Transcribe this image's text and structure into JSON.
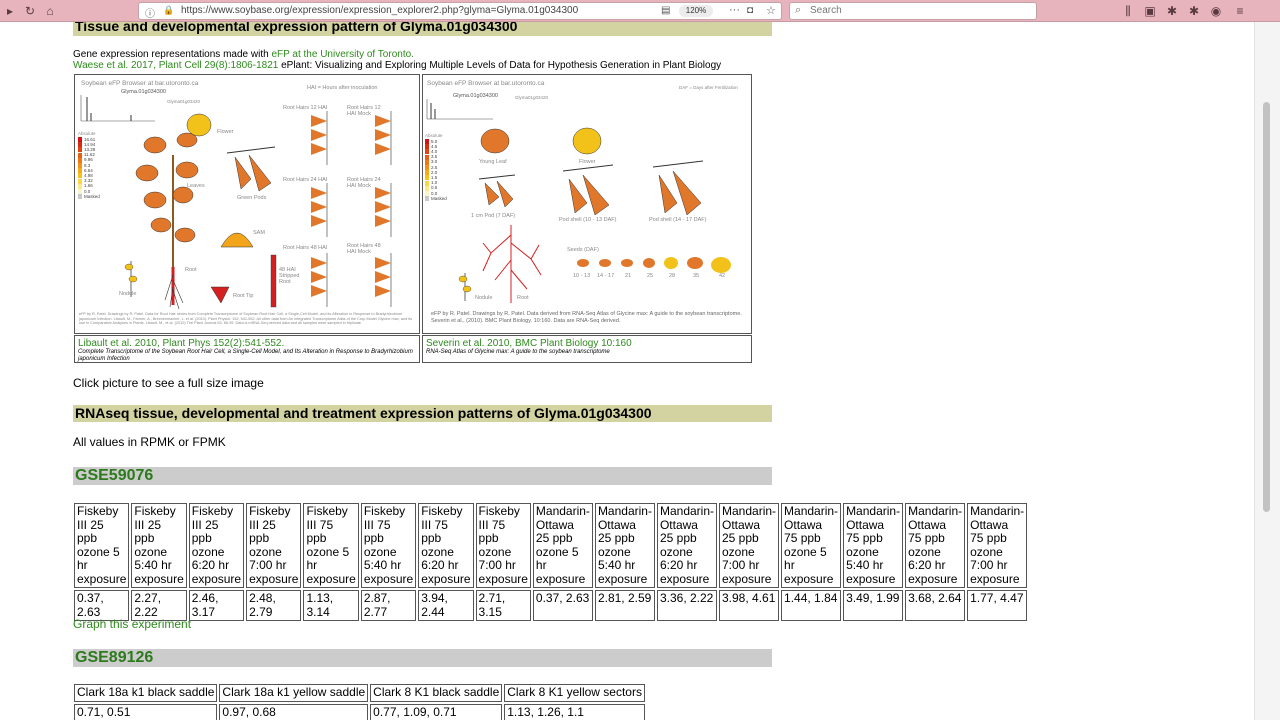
{
  "browser": {
    "url": "https://www.soybase.org/expression/expression_explorer2.php?glyma=Glyma.01g034300",
    "zoom": "120%",
    "search_placeholder": "Search"
  },
  "header": {
    "title": "Tissue and developmental expression pattern of Glyma.01g034300",
    "line1_prefix": "Gene expression representations made with ",
    "line1_link": "eFP at the University of Toronto.",
    "line2_link": "Waese et al. 2017, Plant Cell 29(8):1806-1821",
    "line2_suffix": " ePlant: Visualizing and Exploring Multiple Levels of Data for Hypothesis Generation in Plant Biology"
  },
  "efp_left": {
    "browser_label": "Soybean eFP Browser at bar.utoronto.ca",
    "gene": "Glyma.01g034300",
    "subgene": "Glyma01g03420",
    "hai_note": "HAI = Hours after inoculation",
    "legend_title": "Absolute",
    "legend_values": [
      "16.61",
      "14.94",
      "13.28",
      "11.62",
      "9.96",
      "8.3",
      "6.64",
      "4.98",
      "3.32",
      "1.66",
      "0.0",
      "Masked"
    ],
    "labels": {
      "flower": "Flower",
      "leaves": "Leaves",
      "green_pods": "Green Pods",
      "sam": "SAM",
      "root": "Root",
      "nodule": "Nodule",
      "root_tip": "Root Tip",
      "stripped_root": "48 HAI Stripped Root",
      "rh12": "Root Hairs 12 HAI",
      "rh12m": "Root Hairs 12 HAI Mock",
      "rh24": "Root Hairs 24 HAI",
      "rh24m": "Root Hairs 24 HAI Mock",
      "rh48": "Root Hairs 48 HAI",
      "rh48m": "Root Hairs 48 HAI Mock"
    },
    "footer": "eFP by R. Patel. Drawings by R. Patel. Data for Root Hair series from Complete Transcriptome of Soybean Root Hair Cell, a Single-Cell Model, and its Alteration in Response to Bradyrhizobium japonicum infection. Libault, M., Farmer, A., Brechenmacher, L. et al. (2010). Plant Physiol. 152, 541-552. All other data from An Integrated Transcriptome Atlas of the Crop Model Glycine max, and its use in Comparative Analyses in Plants. Libault, M., et al. (2010) The Plant Journal 63, 86-99. Data is mRNA-Seq derived data and all samples were sampled in triplicate.",
    "caption_title": "Libault et al. 2010, Plant Phys 152(2):541-552.",
    "caption_text": "Complete Transcriptome of the Soybean Root Hair Cell, a Single-Cell Model, and Its Alteration in Response to Bradyrhizobium japonicum Infection"
  },
  "efp_right": {
    "browser_label": "Soybean eFP Browser at bar.utoronto.ca",
    "gene": "Glyma.01g034300",
    "subgene": "Glyma01g03420",
    "daf_note": "DAF = Days after Fertilization",
    "legend_title": "Absolute",
    "legend_values": [
      "5.0",
      "4.5",
      "4.0",
      "3.5",
      "3.0",
      "2.5",
      "2.0",
      "1.5",
      "1.0",
      "0.5",
      "0.0",
      "Masked"
    ],
    "labels": {
      "young_leaf": "Young Leaf",
      "flower": "Flower",
      "pod1": "1 cm Pod (7 DAF)",
      "pod_shell1": "Pod shell (10 - 13 DAF)",
      "pod_shell2": "Pod shell (14 - 17 DAF)",
      "seeds": "Seeds (DAF)",
      "nodule": "Nodule",
      "root": "Root"
    },
    "seed_days": [
      "10 - 13",
      "14 - 17",
      "21",
      "25",
      "28",
      "35",
      "42"
    ],
    "footer": "eFP by R. Patel. Drawings by R. Patel. Data derived from RNA-Seq Atlas of Glycine max: A guide to the soybean transcriptome. Severin et al., (2010). BMC Plant Biology. 10:160. Data are RNA-Seq derived.",
    "caption_title": "Severin et al. 2010, BMC Plant Biology 10:160",
    "caption_text": "RNA-Seq Atlas of Glycine max: A guide to the soybean transcriptome"
  },
  "click_note": "Click picture to see a full size image",
  "rnaseq": {
    "title": "RNAseq tissue, developmental and treatment expression patterns of Glyma.01g034300",
    "note": "All values in RPMK or FPMK"
  },
  "gse1": {
    "id": "GSE59076",
    "headers": [
      "Fiskeby III 25 ppb ozone 5 hr exposure",
      "Fiskeby III 25 ppb ozone 5:40 hr exposure",
      "Fiskeby III 25 ppb ozone 6:20 hr exposure",
      "Fiskeby III 25 ppb ozone 7:00 hr exposure",
      "Fiskeby III 75 ppb ozone 5 hr exposure",
      "Fiskeby III 75 ppb ozone 5:40 hr exposure",
      "Fiskeby III 75 ppb ozone 6:20 hr exposure",
      "Fiskeby III 75 ppb ozone 7:00 hr exposure",
      "Mandarin-Ottawa 25 ppb ozone 5 hr exposure",
      "Mandarin-Ottawa 25 ppb ozone 5:40 hr exposure",
      "Mandarin-Ottawa 25 ppb ozone 6:20 hr exposure",
      "Mandarin-Ottawa 25 ppb ozone 7:00 hr exposure",
      "Mandarin-Ottawa 75 ppb ozone 5 hr exposure",
      "Mandarin-Ottawa 75 ppb ozone 5:40 hr exposure",
      "Mandarin-Ottawa 75 ppb ozone 6:20 hr exposure",
      "Mandarin-Ottawa 75 ppb ozone 7:00 hr exposure"
    ],
    "values": [
      "0.37, 2.63",
      "2.27, 2.22",
      "2.46, 3.17",
      "2.48, 2.79",
      "1.13, 3.14",
      "2.87, 2.77",
      "3.94, 2.44",
      "2.71, 3.15",
      "0.37, 2.63",
      "2.81, 2.59",
      "3.36, 2.22",
      "3.98, 4.61",
      "1.44, 1.84",
      "3.49, 1.99",
      "3.68, 2.64",
      "1.77, 4.47"
    ],
    "graph_link": "Graph this experiment"
  },
  "gse2": {
    "id": "GSE89126",
    "headers": [
      "Clark 18a k1 black saddle",
      "Clark 18a k1 yellow saddle",
      "Clark 8 K1 black saddle",
      "Clark 8 K1 yellow sectors"
    ],
    "values": [
      "0.71, 0.51",
      "0.97, 0.68",
      "0.77, 1.09, 0.71",
      "1.13, 1.26, 1.1"
    ]
  },
  "colors": {
    "banner_olive": "#d3d3a2",
    "banner_gray": "#cccccc",
    "link_green": "#2f8a1e",
    "chrome_pink": "#e7b4bd",
    "efp_orange": "#e0772a",
    "efp_red": "#d42020",
    "efp_yellow": "#f2c21a"
  }
}
